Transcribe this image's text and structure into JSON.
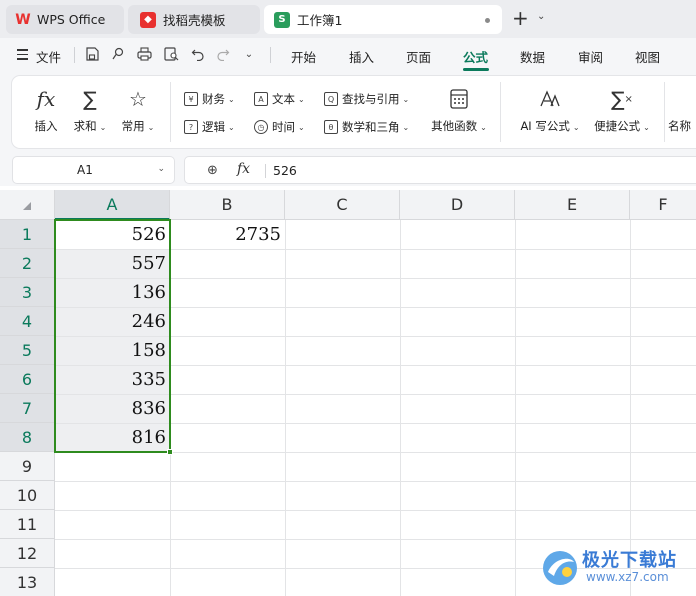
{
  "tabs": [
    {
      "label": "WPS Office",
      "icon": "wps-logo-icon"
    },
    {
      "label": "找稻壳模板",
      "icon": "daoke-template-icon"
    },
    {
      "label": "工作簿1",
      "icon": "spreadsheet-s-icon"
    }
  ],
  "menu": {
    "file_label": "文件",
    "tabs": [
      "开始",
      "插入",
      "页面",
      "公式",
      "数据",
      "审阅",
      "视图"
    ],
    "active_tab": "公式"
  },
  "ribbon": {
    "insert_function": "插入",
    "sum": "求和",
    "common": "常用",
    "finance": "财务",
    "text": "文本",
    "lookup": "查找与引用",
    "logic": "逻辑",
    "time": "时间",
    "math": "数学和三角",
    "other_functions": "其他函数",
    "ai_formula": "AI 写公式",
    "quick_formula": "便捷公式",
    "name_partial": "名称"
  },
  "formula_bar": {
    "cell_ref": "A1",
    "fx": "fx",
    "value": "526"
  },
  "sheet": {
    "columns": [
      "A",
      "B",
      "C",
      "D",
      "E",
      "F"
    ],
    "rows": [
      "1",
      "2",
      "3",
      "4",
      "5",
      "6",
      "7",
      "8",
      "9",
      "10",
      "11",
      "12",
      "13"
    ],
    "col_a_values": [
      "526",
      "557",
      "136",
      "246",
      "158",
      "335",
      "836",
      "816"
    ],
    "b1_value": "2735"
  },
  "colors": {
    "accent": "#0b7a5c",
    "selection_border": "#2e8b1e"
  },
  "watermark": {
    "name": "极光下载站",
    "url": "www.xz7.com"
  }
}
